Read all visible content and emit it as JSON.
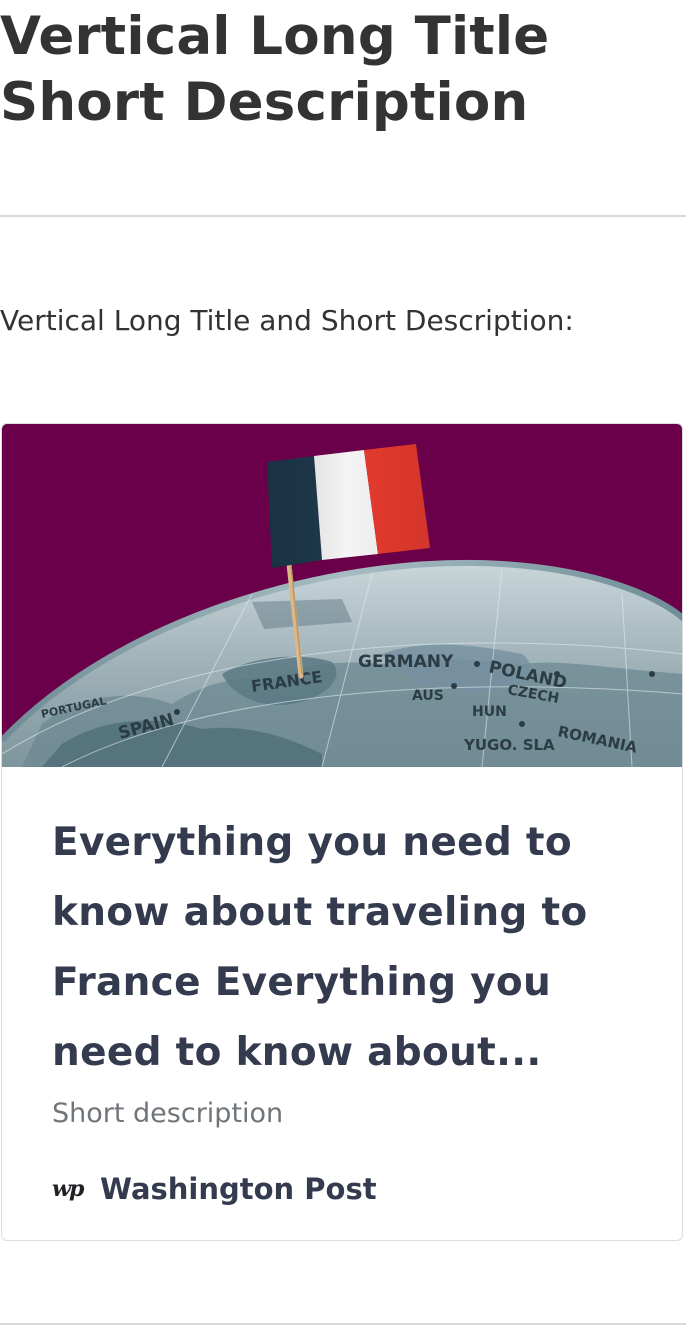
{
  "page": {
    "title": "Vertical Long Title Short Description",
    "intro": "Vertical Long Title and Short Description:"
  },
  "card": {
    "image_icon": "globe-with-france-flag-image",
    "title": "Everything you need to know about traveling to France Everything you need to know about...",
    "description": "Short description",
    "source": {
      "icon": "washington-post-logo-icon",
      "icon_text": "wp",
      "name": "Washington Post"
    },
    "map_labels": {
      "germany": "GERMANY",
      "poland": "POLAND",
      "france": "FRANCE",
      "spain": "SPAIN",
      "austria": "AUS",
      "czech": "CZECH",
      "hungary": "HUN",
      "romania": "ROMANIA",
      "yugo": "YUGO. SLA",
      "portugal": "PORTUGAL"
    }
  },
  "colors": {
    "title_text": "#333333",
    "card_title": "#353b4e",
    "description": "#70757a",
    "image_background": "#6a0049",
    "flag_blue": "#1e3a4d",
    "flag_white": "#f4f4f4",
    "flag_red": "#e63a2e"
  }
}
